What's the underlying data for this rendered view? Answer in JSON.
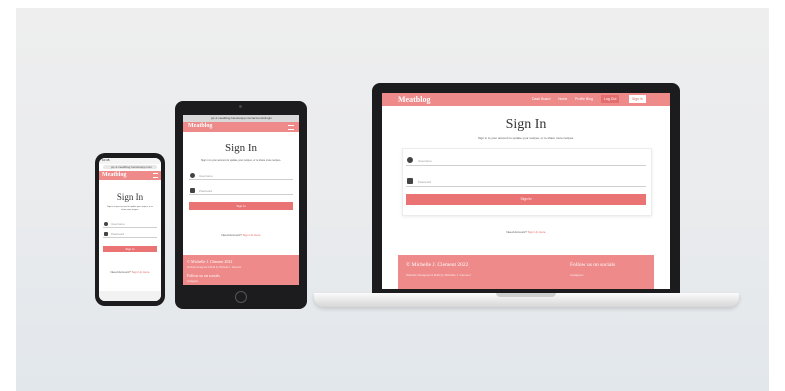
{
  "app": {
    "brand": "Meatblog",
    "theme_color": "#ee8a8a",
    "button_color": "#ea7373"
  },
  "nav": {
    "links": [
      "Dash Board",
      "Home",
      "Profile Blog",
      "Log Out",
      "Sign in"
    ]
  },
  "signin": {
    "title": "Sign In",
    "subtitle": "Sign in to your account to update your recipes, or to share more recipes.",
    "username_placeholder": "Username",
    "password_placeholder": "Password",
    "button_label": "Sign In",
    "register_prompt": "Need Account?",
    "register_link": "Sign Up Here"
  },
  "footer": {
    "copyright": "© Michelle J. Clement 2022",
    "credit": "Website Designed & Built by Michelle J. Clement",
    "follow_heading": "Follow us on socials",
    "social_item": "Instagram"
  },
  "phone": {
    "status_time": "10:45",
    "url": "pp-4-meatblog.herokuapp.com"
  },
  "tablet": {
    "url": "pp-4-meatblog.herokuapp.com/accounts/login"
  },
  "icons": [
    "user-icon",
    "lock-icon",
    "hamburger-icon"
  ]
}
